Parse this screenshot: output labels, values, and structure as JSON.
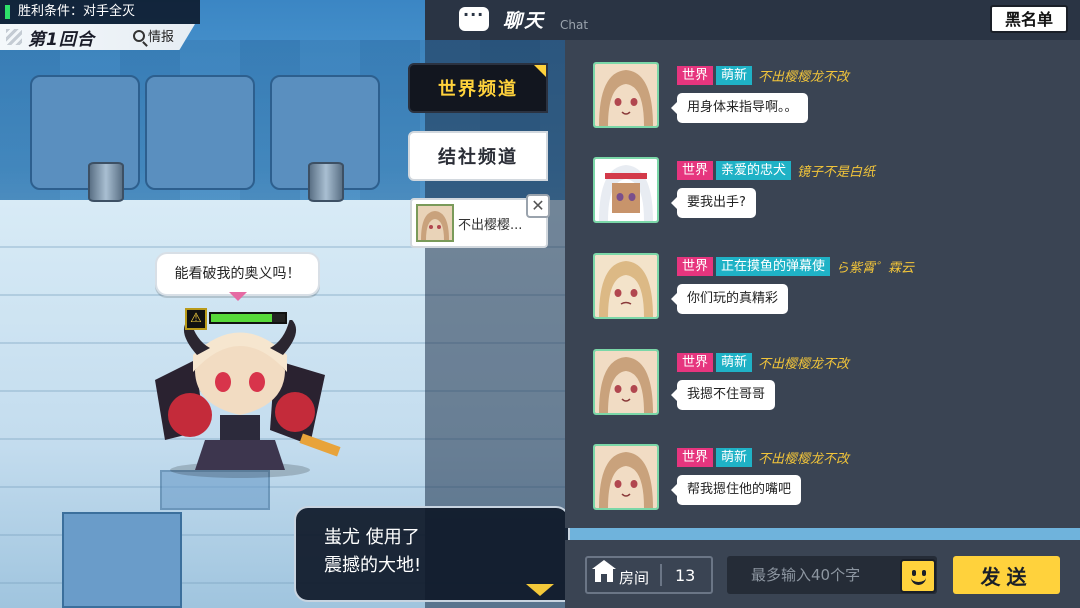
{
  "hud": {
    "victory_condition": "胜利条件：对手全灭",
    "round": "第1回合",
    "info": "情报"
  },
  "battle": {
    "speech": "能看破我的奥义吗！",
    "hp_tag": "⚠",
    "hp_fraction": 0.82,
    "log_line1": "蚩尤 使用了",
    "log_line2": "震撼的大地!"
  },
  "channels": {
    "world": "世界频道",
    "guild": "结社频道",
    "preview_text": "不出樱樱...",
    "close_icon": "✕"
  },
  "chat": {
    "title": "聊天",
    "subtitle": "Chat",
    "blacklist": "黑名单",
    "messages": [
      {
        "channel": "世界",
        "title": "萌新",
        "name": "不出樱樱龙不改",
        "text": "用身体来指导啊。。",
        "avatar": "light"
      },
      {
        "channel": "世界",
        "title": "亲爱的忠犬",
        "name": "镜子不是白纸",
        "text": "要我出手?",
        "avatar": "white"
      },
      {
        "channel": "世界",
        "title": "正在摸鱼的弹幕使",
        "name": "ら紫霄゜霖云",
        "text": "你们玩的真精彩",
        "avatar": "blonde"
      },
      {
        "channel": "世界",
        "title": "萌新",
        "name": "不出樱樱龙不改",
        "text": "我摁不住哥哥",
        "avatar": "light"
      },
      {
        "channel": "世界",
        "title": "萌新",
        "name": "不出樱樱龙不改",
        "text": "帮我摁住他的嘴吧",
        "avatar": "light"
      }
    ]
  },
  "bottom": {
    "room_label": "房间",
    "room_number": "13",
    "input_placeholder": "最多输入40个字",
    "send": "发送"
  },
  "colors": {
    "world_tag": "#e6357e",
    "guild_tag": "#1fb2c6",
    "username": "#f2c53a",
    "accent_yellow": "#ffd23c",
    "panel": "#3a4453"
  }
}
